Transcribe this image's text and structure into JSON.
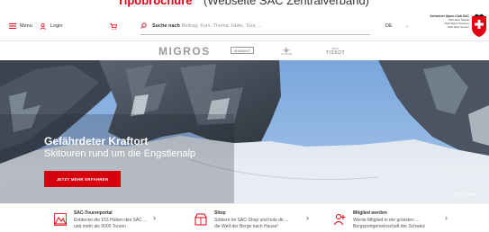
{
  "caption": {
    "red": "Tipobrochure",
    "rest": "(Webseite SAC Zentralverband)"
  },
  "header": {
    "menu_label": "Menu",
    "login_label": "Login",
    "search_bold": "Suche nach",
    "search_placeholder": "Beitrag, Kurs, Thema, Hütte, Tour, ...",
    "language": "DE",
    "org_line1": "Schweizer Alpen-Club SAC",
    "org_line2": "Club Alpin Suisse",
    "org_line3": "Club Alpino Svizzero",
    "org_line4": "Club Alpin Svizzer"
  },
  "sponsors": {
    "s1": "MIGROS",
    "s2": "MAMMUT",
    "s3": "LOTTERIE",
    "s4a": "RSD",
    "s4b": "TISSOT"
  },
  "hero": {
    "title": "Gefährdeter Kraftort",
    "subtitle": "Skitouren rund um die Engstlenalp",
    "cta": "JETZT MEHR ERFAHREN",
    "credit": "© Iris Kürschner"
  },
  "cards": [
    {
      "title": "SAC-Tourenportal",
      "line1": "Entdecke die 153 Hütten des SAC ...",
      "line2": "und mehr als 9000 Touren"
    },
    {
      "title": "Shop",
      "line1": "Stöbere im SAC-Shop und hole dir ...",
      "line2": "die Welt der Berge nach Hause!"
    },
    {
      "title": "Mitglied werden",
      "line1": "Werde Mitglied in der grössten ...",
      "line2": "Bergsportgemeinschaft der Schweiz"
    }
  ],
  "colors": {
    "accent": "#e3000f",
    "button": "#d7000f"
  }
}
